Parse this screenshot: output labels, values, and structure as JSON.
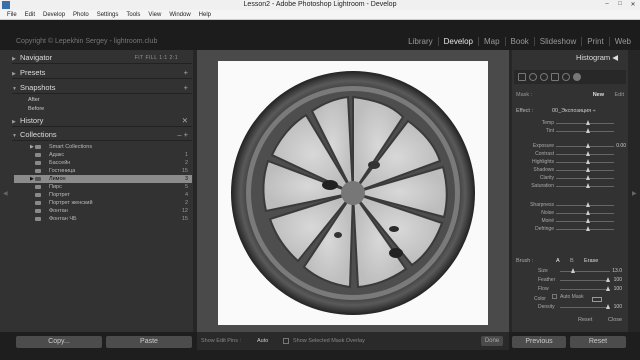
{
  "window": {
    "title": "Lesson2 - Adobe Photoshop Lightroom - Develop",
    "controls": [
      "–",
      "□",
      "✕"
    ]
  },
  "menu": [
    "File",
    "Edit",
    "Develop",
    "Photo",
    "Settings",
    "Tools",
    "View",
    "Window",
    "Help"
  ],
  "identity": "Copyright © Lepekhin Sergey - lightroom.club",
  "modules": [
    {
      "label": "Library",
      "active": false
    },
    {
      "label": "Develop",
      "active": true
    },
    {
      "label": "Map",
      "active": false
    },
    {
      "label": "Book",
      "active": false
    },
    {
      "label": "Slideshow",
      "active": false
    },
    {
      "label": "Print",
      "active": false
    },
    {
      "label": "Web",
      "active": false
    }
  ],
  "left": {
    "navigator": {
      "label": "Navigator",
      "modes": "FIT  FILL  1:1  2:1"
    },
    "presets": {
      "label": "Presets"
    },
    "snapshots": {
      "label": "Snapshots",
      "items": [
        "After",
        "Before"
      ]
    },
    "history": {
      "label": "History"
    },
    "collections": {
      "label": "Collections",
      "items": [
        {
          "name": "Smart Collections",
          "count": "",
          "smart": true
        },
        {
          "name": "Адакс",
          "count": "1"
        },
        {
          "name": "Бассейн",
          "count": "2"
        },
        {
          "name": "Гостиница",
          "count": "15"
        },
        {
          "name": "Лимон",
          "count": "3",
          "selected": true
        },
        {
          "name": "Пирс",
          "count": "5"
        },
        {
          "name": "Портрет",
          "count": "4"
        },
        {
          "name": "Портрет женский",
          "count": "2"
        },
        {
          "name": "Фонтан",
          "count": "12"
        },
        {
          "name": "Фонтан ЧБ",
          "count": "15"
        }
      ]
    },
    "copy_label": "Copy...",
    "paste_label": "Paste"
  },
  "center": {
    "show_edit_pins": "Show Edit Pins :",
    "pins_value": "Auto",
    "show_overlay": "Show Selected Mask Overlay",
    "done_label": "Done"
  },
  "right": {
    "histogram": "Histogram",
    "mask": {
      "label": "Mask :",
      "new": "New",
      "edit": "Edit"
    },
    "effect": {
      "label": "Effect :",
      "value": "00_Экспозиция ÷"
    },
    "sliders": [
      {
        "label": "Temp",
        "value": "",
        "pos": 0.55
      },
      {
        "label": "Tint",
        "value": "",
        "pos": 0.55
      },
      {
        "label": "Exposure",
        "value": "0.00",
        "pos": 0.55
      },
      {
        "label": "Contrast",
        "value": "",
        "pos": 0.55
      },
      {
        "label": "Highlights",
        "value": "",
        "pos": 0.55
      },
      {
        "label": "Shadows",
        "value": "",
        "pos": 0.55
      },
      {
        "label": "Clarity",
        "value": "",
        "pos": 0.55
      },
      {
        "label": "Saturation",
        "value": "",
        "pos": 0.55
      },
      {
        "label": "Sharpness",
        "value": "",
        "pos": 0.55
      },
      {
        "label": "Noise",
        "value": "",
        "pos": 0.55
      },
      {
        "label": "Moiré",
        "value": "",
        "pos": 0.55
      },
      {
        "label": "Defringe",
        "value": "",
        "pos": 0.55
      }
    ],
    "color_label": "Color",
    "brush": {
      "label": "Brush :",
      "a": "A",
      "b": "B",
      "erase": "Erase"
    },
    "brush_sliders": [
      {
        "label": "Size",
        "value": "13.0",
        "pos": 0.25
      },
      {
        "label": "Feather",
        "value": "100",
        "pos": 0.96
      },
      {
        "label": "Flow",
        "value": "100",
        "pos": 0.96
      },
      {
        "label": "Density",
        "value": "100",
        "pos": 0.96
      }
    ],
    "auto_mask": "Auto Mask",
    "reset": "Reset",
    "close": "Close",
    "previous_label": "Previous",
    "reset_label": "Reset"
  }
}
